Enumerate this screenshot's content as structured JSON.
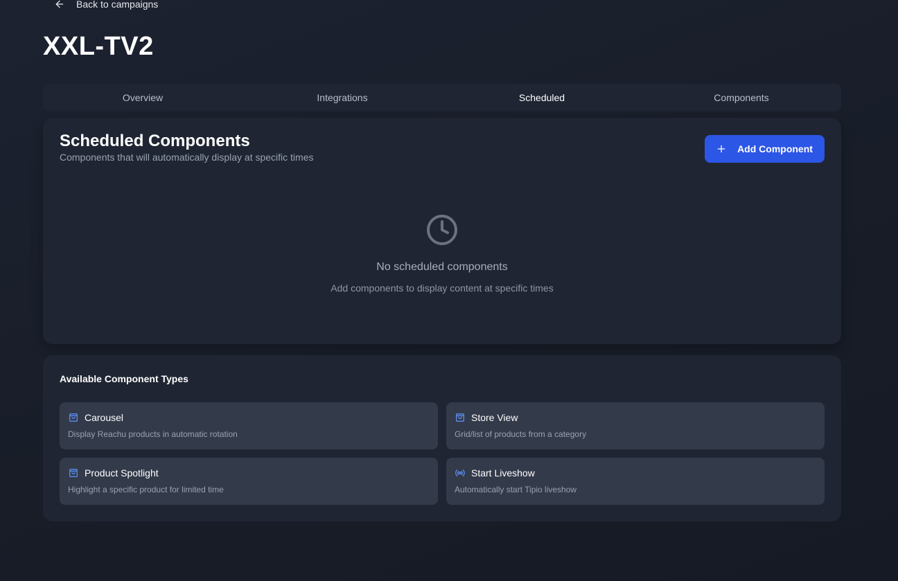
{
  "nav": {
    "back_label": "Back to campaigns"
  },
  "campaign": {
    "title": "XXL-TV2"
  },
  "tabs": [
    {
      "label": "Overview",
      "active": false
    },
    {
      "label": "Integrations",
      "active": false
    },
    {
      "label": "Scheduled",
      "active": true
    },
    {
      "label": "Components",
      "active": false
    }
  ],
  "scheduled": {
    "title": "Scheduled Components",
    "subtitle": "Components that will automatically display at specific times",
    "add_label": "Add Component",
    "empty_title": "No scheduled components",
    "empty_subtitle": "Add components to display content at specific times"
  },
  "available": {
    "title": "Available Component Types",
    "items": [
      {
        "name": "Carousel",
        "description": "Display Reachu products in automatic rotation",
        "icon": "shopping-bag-icon"
      },
      {
        "name": "Store View",
        "description": "Grid/list of products from a category",
        "icon": "shopping-bag-icon"
      },
      {
        "name": "Product Spotlight",
        "description": "Highlight a specific product for limited time",
        "icon": "shopping-bag-icon"
      },
      {
        "name": "Start Liveshow",
        "description": "Automatically start Tipio liveshow",
        "icon": "broadcast-icon"
      }
    ]
  },
  "colors": {
    "accent": "#2c56e6",
    "icon_blue": "#5b8def",
    "panel": "#1f2533",
    "card": "#333a4a"
  }
}
